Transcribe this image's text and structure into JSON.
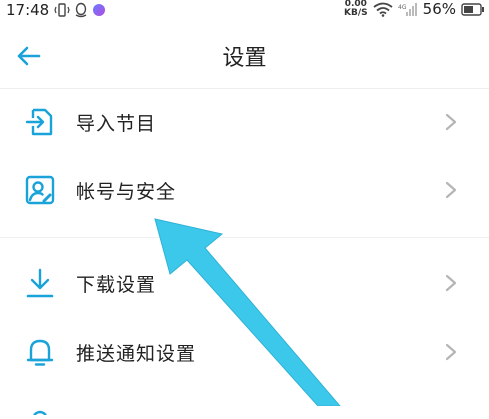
{
  "status_bar": {
    "time": "17:48",
    "net_speed_value": "0.00",
    "net_speed_unit": "KB/S",
    "signal_label": "4G",
    "battery_percent": "56%"
  },
  "header": {
    "title": "设置",
    "back_icon": "arrow-left-icon"
  },
  "colors": {
    "accent": "#1aa3d9",
    "arrow_annotation": "#3cc8ea",
    "chevron": "#b5b5b5"
  },
  "settings": {
    "items": [
      {
        "label": "导入节目",
        "icon": "import-icon"
      },
      {
        "label": "帐号与安全",
        "icon": "account-security-icon"
      },
      {
        "label": "下载设置",
        "icon": "download-icon"
      },
      {
        "label": "推送通知设置",
        "icon": "bell-icon"
      }
    ]
  }
}
